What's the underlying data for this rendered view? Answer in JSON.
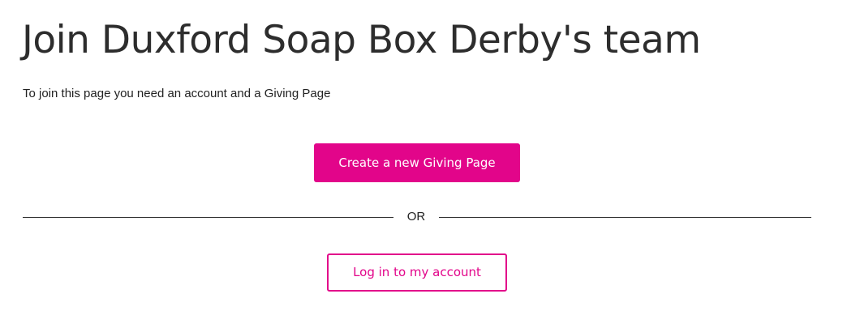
{
  "page": {
    "title": "Join Duxford Soap Box Derby's team",
    "intro": "To join this page you need an account and a Giving Page"
  },
  "actions": {
    "create_label": "Create a new Giving Page",
    "divider_label": "OR",
    "login_label": "Log in to my account"
  },
  "colors": {
    "brand": "#e2058a",
    "text": "#2d2d2d",
    "divider": "#333333"
  }
}
